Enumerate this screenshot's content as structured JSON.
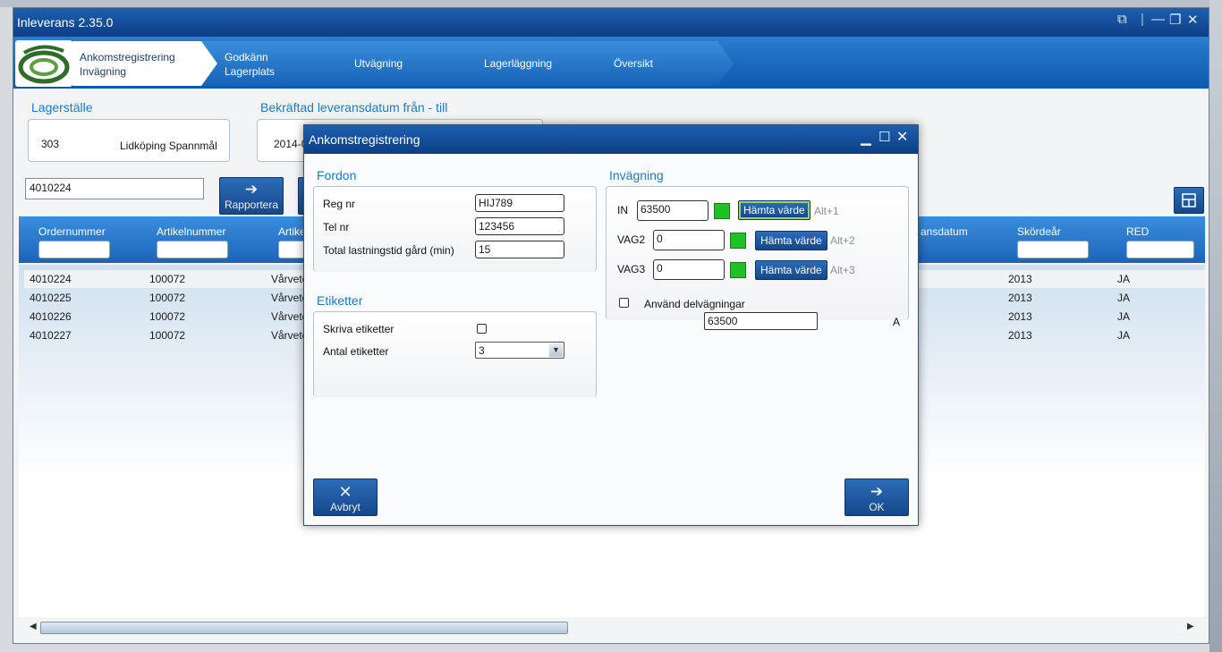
{
  "app": {
    "title": "Inleverans 2.35.0"
  },
  "steps": [
    {
      "line1": "Ankomstregistrering",
      "line2": "Invägning"
    },
    {
      "line1": "Godkänn",
      "line2": "Lagerplats"
    },
    {
      "line1": "Utvägning",
      "line2": ""
    },
    {
      "line1": "Lagerläggning",
      "line2": ""
    },
    {
      "line1": "Översikt",
      "line2": ""
    }
  ],
  "filters": {
    "lagerstalle_label": "Lagerställe",
    "lagerstalle_code": "303",
    "lagerstalle_name": "Lidköping Spannmål",
    "date_label": "Bekräftad leveransdatum från - till",
    "date_value": "2014-0",
    "search_value": "4010224",
    "rapportera_label": "Rapportera"
  },
  "grid": {
    "columns": [
      "Ordernummer",
      "Artikelnummer",
      "Artike",
      "ansdatum",
      "Skördeår",
      "RED"
    ],
    "rows": [
      {
        "order": "4010224",
        "artikel": "100072",
        "artname": "Vårvete",
        "year": "2013",
        "red": "JA"
      },
      {
        "order": "4010225",
        "artikel": "100072",
        "artname": "Vårvete",
        "year": "2013",
        "red": "JA"
      },
      {
        "order": "4010226",
        "artikel": "100072",
        "artname": "Vårvete",
        "year": "2013",
        "red": "JA"
      },
      {
        "order": "4010227",
        "artikel": "100072",
        "artname": "Vårvete",
        "year": "2013",
        "red": "JA"
      }
    ]
  },
  "dialog": {
    "title": "Ankomstregistrering",
    "fordon": {
      "title": "Fordon",
      "reg_label": "Reg nr",
      "reg_value": "HIJ789",
      "tel_label": "Tel nr",
      "tel_value": "123456",
      "time_label": "Total lastningstid gård (min)",
      "time_value": "15"
    },
    "etiketter": {
      "title": "Etiketter",
      "skriva_label": "Skriva etiketter",
      "antal_label": "Antal etiketter",
      "antal_value": "3"
    },
    "invagning": {
      "title": "Invägning",
      "in_label": "IN",
      "in_value": "63500",
      "in_alt": "Alt+1",
      "vag2_label": "VAG2",
      "vag2_value": "0",
      "vag2_alt": "Alt+2",
      "vag3_label": "VAG3",
      "vag3_value": "0",
      "vag3_alt": "Alt+3",
      "hamta_label": "Hämta värde",
      "delvag_label": "Använd delvägningar",
      "total_value": "63500",
      "total_unit": "A"
    },
    "cancel_label": "Avbryt",
    "ok_label": "OK"
  }
}
